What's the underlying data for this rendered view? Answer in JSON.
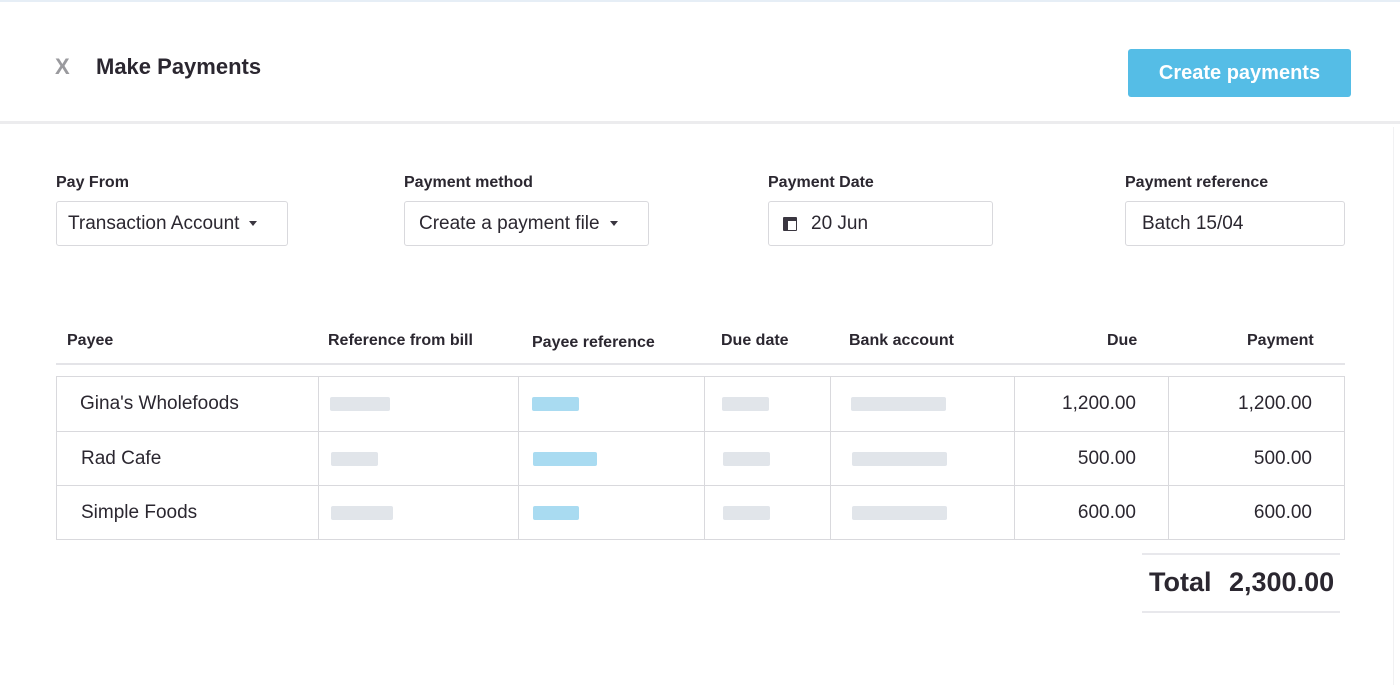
{
  "header": {
    "close_label": "X",
    "title": "Make Payments",
    "create_button": "Create payments"
  },
  "form": {
    "pay_from": {
      "label": "Pay From",
      "value": "Transaction Account"
    },
    "payment_method": {
      "label": "Payment method",
      "value": "Create a payment file"
    },
    "payment_date": {
      "label": "Payment Date",
      "value": "20 Jun"
    },
    "payment_reference": {
      "label": "Payment reference",
      "value": "Batch 15/04"
    }
  },
  "table": {
    "columns": [
      "Payee",
      "Reference from bill",
      "Payee reference",
      "Due date",
      "Bank account",
      "Due",
      "Payment"
    ],
    "rows": [
      {
        "payee": "Gina's Wholefoods",
        "due": "1,200.00",
        "payment": "1,200.00"
      },
      {
        "payee": "Rad Cafe",
        "due": "500.00",
        "payment": "500.00"
      },
      {
        "payee": "Simple Foods",
        "due": "600.00",
        "payment": "600.00"
      }
    ]
  },
  "total": {
    "label": "Total",
    "value": "2,300.00"
  },
  "colors": {
    "accent": "#55bde6",
    "placeholder_blue": "#a9dbf1",
    "placeholder_gray": "#e1e5ea"
  }
}
